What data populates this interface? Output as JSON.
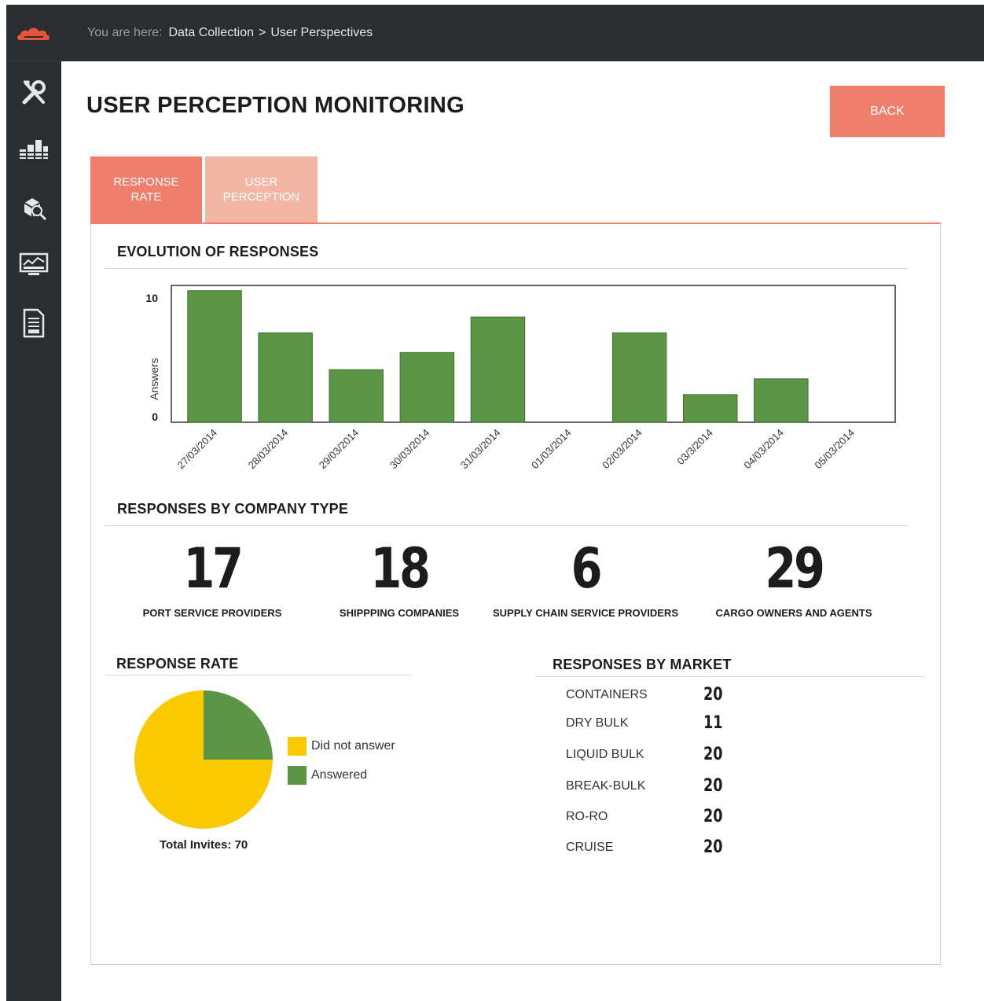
{
  "breadcrumb": {
    "prefix": "You are here:",
    "items": [
      "Data Collection",
      "User Perspectives"
    ],
    "separator": ">"
  },
  "page": {
    "title": "USER PERCEPTION MONITORING",
    "back_label": "BACK"
  },
  "tabs": [
    {
      "line1": "RESPONSE",
      "line2": "RATE",
      "active": true
    },
    {
      "line1": "USER",
      "line2": "PERCEPTION",
      "active": false
    }
  ],
  "sections": {
    "evolution": "EVOLUTION OF RESPONSES",
    "company_type": "RESPONSES BY COMPANY TYPE",
    "response_rate": "RESPONSE RATE",
    "market": "RESPONSES BY MARKET"
  },
  "chart_data": [
    {
      "type": "bar",
      "ylabel": "Answers",
      "ytick_labels": [
        "10",
        "0"
      ],
      "ylim": [
        0,
        10.4
      ],
      "categories": [
        "27/03/2014",
        "28/03/2014",
        "29/03/2014",
        "30/03/2014",
        "31/03/2014",
        "01/03/2014",
        "02/03/2014",
        "03/3/2014",
        "04/03/2014",
        "05/03/2014"
      ],
      "values": [
        10,
        6.8,
        4,
        5.3,
        8,
        0,
        6.8,
        2.1,
        3.3,
        0
      ],
      "color": "#5a9645"
    },
    {
      "type": "pie",
      "labels": [
        "Did not answer",
        "Answered"
      ],
      "values": [
        75,
        25
      ],
      "colors": [
        "#fbc900",
        "#5a9645"
      ]
    }
  ],
  "company_types": [
    {
      "value": "17",
      "label": "PORT SERVICE PROVIDERS"
    },
    {
      "value": "18",
      "label": "SHIPPPING COMPANIES"
    },
    {
      "value": "6",
      "label": "SUPPLY CHAIN SERVICE PROVIDERS"
    },
    {
      "value": "29",
      "label": "CARGO OWNERS AND AGENTS"
    }
  ],
  "response_rate": {
    "total_invites": "Total Invites: 70"
  },
  "markets": [
    {
      "name": "CONTAINERS",
      "value": "20"
    },
    {
      "name": "DRY BULK",
      "value": "11"
    },
    {
      "name": "LIQUID BULK",
      "value": "20"
    },
    {
      "name": "BREAK-BULK",
      "value": "20"
    },
    {
      "name": "RO-RO",
      "value": "20"
    },
    {
      "name": "CRUISE",
      "value": "20"
    }
  ],
  "sidebar": {
    "icons": [
      "cloud-logo-icon",
      "tools-icon",
      "bar-chart-icon",
      "search-cube-icon",
      "monitor-dashboard-icon",
      "document-report-icon"
    ]
  }
}
